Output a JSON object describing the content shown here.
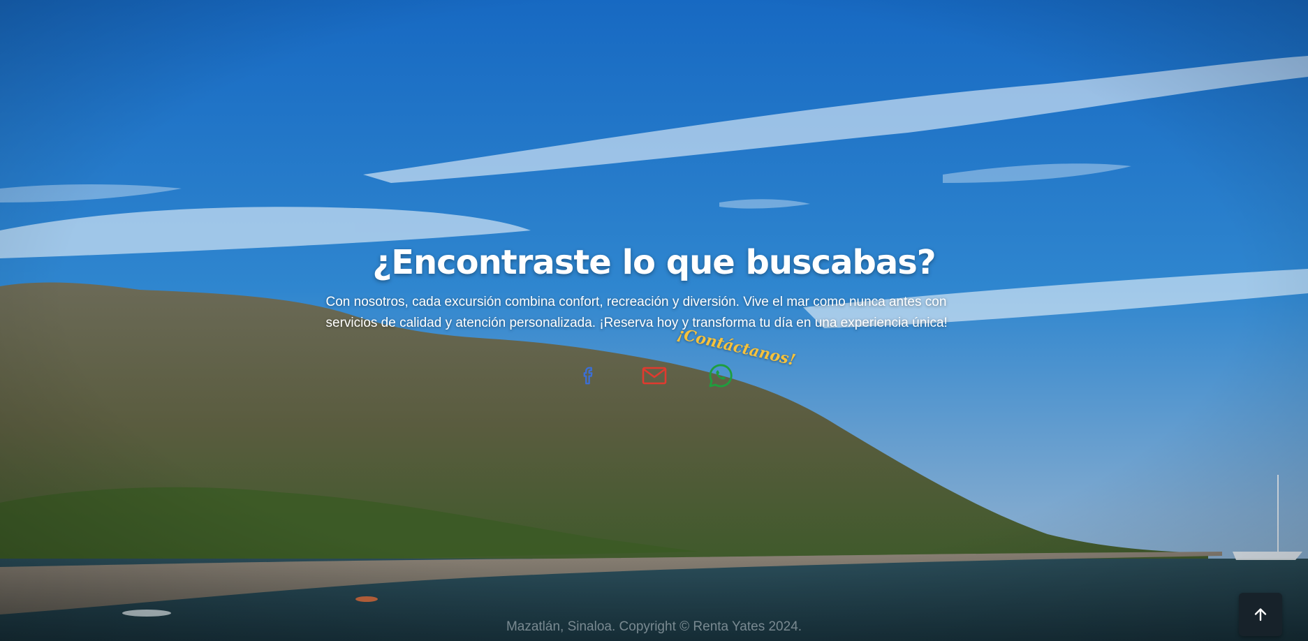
{
  "cta": {
    "headline": "¿Encontraste lo que buscabas?",
    "description": "Con nosotros, cada excursión combina confort, recreación y diversión. Vive el mar como nunca antes con servicios de calidad y atención personalizada. ¡Reserva hoy y transforma tu día en una experiencia única!",
    "contact_callout": "¡Contáctanos!"
  },
  "socials": [
    {
      "name": "facebook",
      "icon": "facebook-icon",
      "color": "#3b6fd8"
    },
    {
      "name": "email",
      "icon": "mail-icon",
      "color": "#e03a2f"
    },
    {
      "name": "whatsapp",
      "icon": "whatsapp-icon",
      "color": "#1f9e3e"
    }
  ],
  "footer": {
    "copyright": "Mazatlán, Sinaloa. Copyright © Renta Yates 2024."
  },
  "scroll_top": {
    "icon": "arrow-up-icon"
  },
  "colors": {
    "sky_top": "#1a6fc0",
    "sky_bottom": "#8fb7d8",
    "sea": "#1f3a44",
    "callout": "#f6c23c",
    "scroll_button": "#17222a"
  }
}
